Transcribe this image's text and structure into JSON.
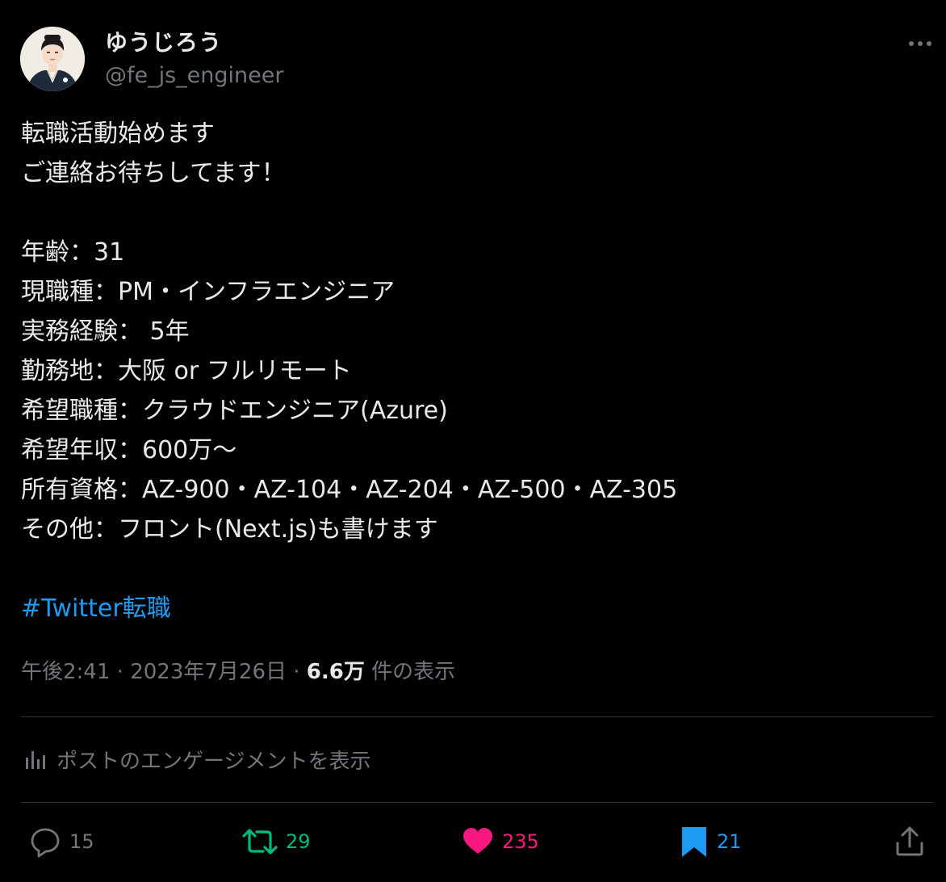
{
  "author": {
    "display_name": "ゆうじろう",
    "handle": "@fe_js_engineer"
  },
  "tweet": {
    "lines": [
      "転職活動始めます",
      "ご連絡お待ちしてます！",
      "",
      "年齢：31",
      "現職種：PM・インフラエンジニア",
      "実務経験： 5年",
      "勤務地：大阪 or フルリモート",
      "希望職種：クラウドエンジニア(Azure)",
      "希望年収：600万〜",
      "所有資格：AZ-900・AZ-104・AZ-204・AZ-500・AZ-305",
      "その他：フロント(Next.js)も書けます"
    ],
    "hashtag": "#Twitter転職"
  },
  "meta": {
    "time": "午後2:41",
    "separator1": " · ",
    "date": "2023年7月26日",
    "separator2": " · ",
    "views_count": "6.6万",
    "views_label": " 件の表示"
  },
  "engagement_label": "ポストのエンゲージメントを表示",
  "actions": {
    "replies": "15",
    "retweets": "29",
    "likes": "235",
    "bookmarks": "21"
  },
  "colors": {
    "background": "#000000",
    "text": "#e7e9ea",
    "muted": "#71767b",
    "link": "#1d9bf0",
    "retweet": "#00ba7c",
    "like": "#f91880",
    "bookmark": "#1d9bf0",
    "divider": "#2f3336"
  },
  "icons": {
    "more": "more-icon",
    "reply": "reply-icon",
    "retweet": "retweet-icon",
    "like": "heart-icon",
    "bookmark": "bookmark-icon",
    "share": "share-icon",
    "analytics": "bar-chart-icon"
  }
}
